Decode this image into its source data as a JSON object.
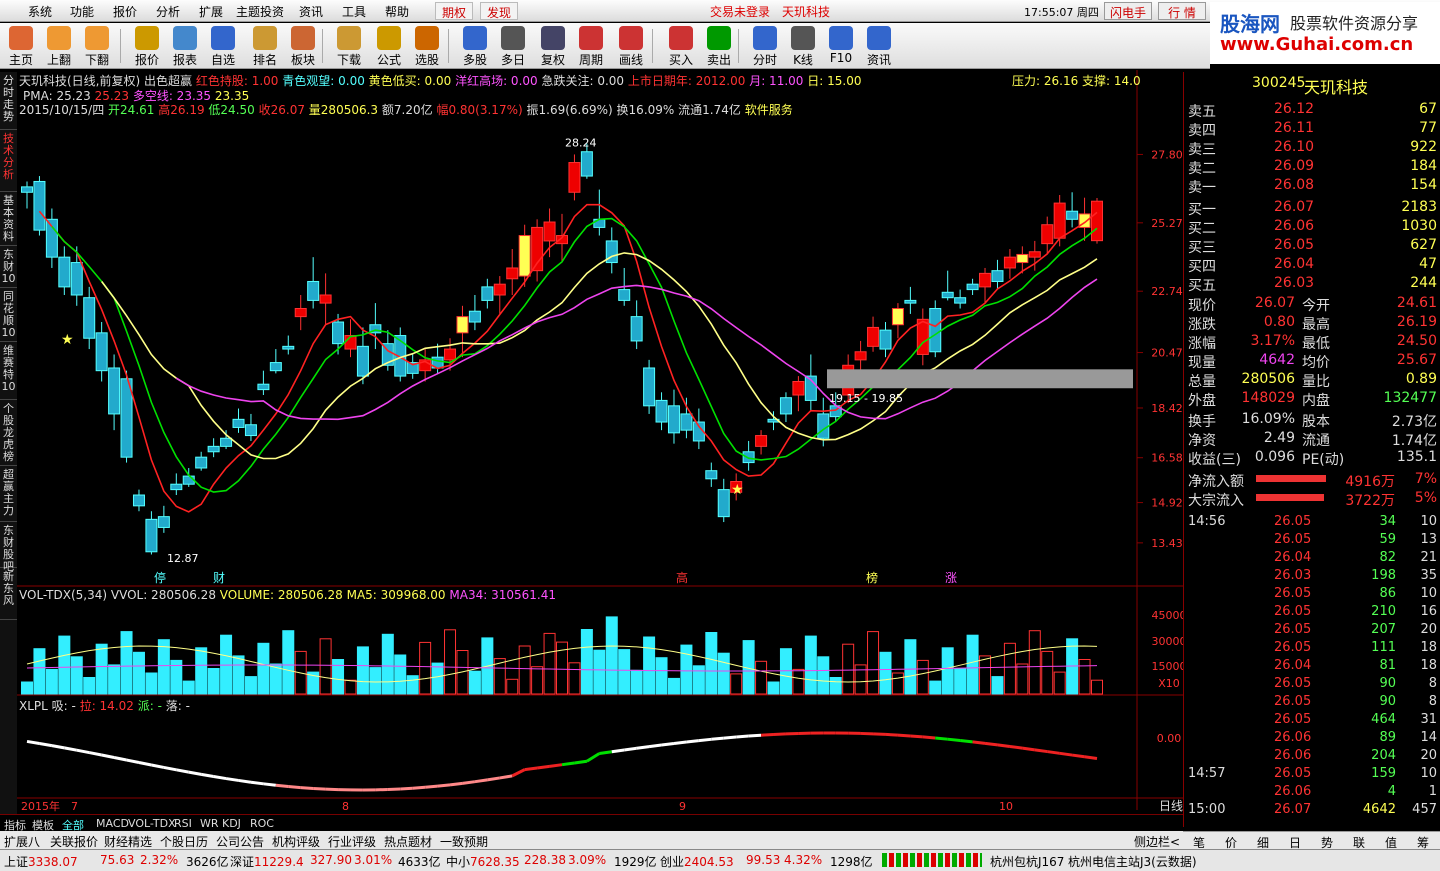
{
  "menu": {
    "items": [
      "系统",
      "功能",
      "报价",
      "分析",
      "扩展",
      "主题投资",
      "资讯",
      "工具",
      "帮助"
    ],
    "tabs": [
      "期权",
      "发现"
    ],
    "notice": "交易未登录",
    "notice_stock": "天玑科技",
    "clock": "17:55:07 周四",
    "btn_flash": "闪电手",
    "btn_quote": "行 情"
  },
  "brand": {
    "site": "股海网",
    "slogan": "股票软件资源分享",
    "url": "www.Guhai.com.cn"
  },
  "toolbar": [
    "主页",
    "上翻",
    "下翻",
    "报价",
    "报表",
    "自选",
    "排名",
    "板块",
    "下载",
    "公式",
    "选股",
    "多股",
    "多日",
    "复权",
    "周期",
    "画线",
    "买入",
    "卖出",
    "分时",
    "K线",
    "F10",
    "资讯"
  ],
  "lefttabs": [
    "分时走势",
    "技术分析",
    "基本资料",
    "东财10",
    "同花顺10",
    "维赛特10",
    "个股龙虎榜",
    "超赢主力",
    "东财股吧",
    "新东风"
  ],
  "header": {
    "title": "天玑科技(日线,前复权)",
    "indicator": "出色超赢",
    "ind1": "红色持股: 1.00",
    "ind2": "青色观望: 0.00",
    "ind3": "黄色低买: 0.00",
    "ind4": "洋红高场: 0.00",
    "ind5": "急跌关注: 0.00",
    "ind6": "上市日期年: 2012.00",
    "ind7": "月: 11.00",
    "ind8": "日: 15.00",
    "pressure": "压力: 26.16",
    "support": "支撑: 14.0",
    "date": "2015/10/15/四",
    "open": "开24.61",
    "high": "高26.19",
    "low": "低24.50",
    "close": "收26.07",
    "vol": "量280506.3",
    "amt": "额7.20亿",
    "chg": "幅0.80(3.17%)",
    "amp": "振1.69(6.69%)",
    "turn": "换16.09%",
    "float": "流通1.74亿",
    "sector": "软件服务",
    "pma": "PMA: 25.23",
    "pma2": "25.23",
    "lk": "多空线: 23.35",
    "lk2": "23.35"
  },
  "price_axis": [
    "27.80",
    "25.27",
    "22.74",
    "20.47",
    "18.42",
    "16.58",
    "14.92",
    "13.43"
  ],
  "annotations": {
    "peak": "28.24",
    "trough": "12.87",
    "band": "19.15 - 19.85",
    "marks": [
      "停",
      "财",
      "高",
      "榜",
      "涨"
    ]
  },
  "vol_header": {
    "title": "VOL-TDX(5,34)",
    "vvol": "VVOL: 280506.28",
    "volume": "VOLUME: 280506.28",
    "ma5": "MA5: 309968.00",
    "ma34": "MA34: 310561.41"
  },
  "vol_axis": [
    "45000",
    "30000",
    "15000",
    "X10"
  ],
  "xlpl_header": {
    "title": "XLPL",
    "a": "吸: -",
    "b": "拉: 14.02",
    "c": "派: -",
    "d": "落: -"
  },
  "xlpl_axis": [
    "0.00"
  ],
  "date_axis": [
    "2015年",
    "7",
    "8",
    "9",
    "10"
  ],
  "period": "日线",
  "chart_data": {
    "type": "candlestick",
    "title": "天玑科技(日线,前复权)",
    "ylim": [
      12.5,
      29.0
    ],
    "last": {
      "date": "2015/10/15",
      "open": 24.61,
      "high": 26.19,
      "low": 24.5,
      "close": 26.07
    },
    "volume_last": 280506.28,
    "ma5": 309968.0,
    "ma34": 310561.41
  },
  "quote": {
    "code": "300245",
    "name": "天玑科技",
    "sell": [
      [
        "卖五",
        "26.12",
        "67"
      ],
      [
        "卖四",
        "26.11",
        "77"
      ],
      [
        "卖三",
        "26.10",
        "922"
      ],
      [
        "卖二",
        "26.09",
        "184"
      ],
      [
        "卖一",
        "26.08",
        "154"
      ]
    ],
    "buy": [
      [
        "买一",
        "26.07",
        "2183"
      ],
      [
        "买二",
        "26.06",
        "1030"
      ],
      [
        "买三",
        "26.05",
        "627"
      ],
      [
        "买四",
        "26.04",
        "47"
      ],
      [
        "买五",
        "26.03",
        "244"
      ]
    ],
    "stats": [
      [
        "现价",
        "26.07",
        "今开",
        "24.61"
      ],
      [
        "涨跌",
        "0.80",
        "最高",
        "26.19"
      ],
      [
        "涨幅",
        "3.17%",
        "最低",
        "24.50"
      ],
      [
        "现量",
        "4642",
        "均价",
        "25.67"
      ],
      [
        "总量",
        "280506",
        "量比",
        "0.89"
      ],
      [
        "外盘",
        "148029",
        "内盘",
        "132477"
      ]
    ],
    "stats2": [
      [
        "换手",
        "16.09%",
        "股本",
        "2.73亿"
      ],
      [
        "净资",
        "2.49",
        "流通",
        "1.74亿"
      ],
      [
        "收益(三)",
        "0.096",
        "PE(动)",
        "135.1"
      ]
    ],
    "flow": [
      [
        "净流入额",
        "4916万",
        "7%"
      ],
      [
        "大宗流入",
        "3722万",
        "5%"
      ]
    ],
    "ticks": [
      [
        "14:56",
        "26.05",
        "34",
        "10"
      ],
      [
        "",
        "26.05",
        "59",
        "13"
      ],
      [
        "",
        "26.04",
        "82",
        "21"
      ],
      [
        "",
        "26.03",
        "198",
        "35"
      ],
      [
        "",
        "26.05",
        "86",
        "10"
      ],
      [
        "",
        "26.05",
        "210",
        "16"
      ],
      [
        "",
        "26.05",
        "207",
        "20"
      ],
      [
        "",
        "26.05",
        "111",
        "18"
      ],
      [
        "",
        "26.04",
        "81",
        "18"
      ],
      [
        "",
        "26.05",
        "90",
        "8"
      ],
      [
        "",
        "26.05",
        "90",
        "8"
      ],
      [
        "",
        "26.05",
        "464",
        "31"
      ],
      [
        "",
        "26.06",
        "89",
        "14"
      ],
      [
        "",
        "26.06",
        "204",
        "20"
      ],
      [
        "14:57",
        "26.05",
        "159",
        "10"
      ],
      [
        "",
        "26.06",
        "4",
        "1"
      ],
      [
        "15:00",
        "26.07",
        "4642",
        "457"
      ]
    ]
  },
  "bottomtabs": [
    "指标",
    "模板",
    "全部",
    "MACD",
    "VOL-TDX",
    "RSI",
    "WR",
    "KDJ",
    "ROC"
  ],
  "bottomtabs2": [
    "扩展八",
    "关联报价",
    "财经精选",
    "个股日历",
    "公司公告",
    "机构评级",
    "行业评级",
    "热点题材",
    "一致预期"
  ],
  "sidebar_btn": "侧边栏<",
  "rtabs": [
    "笔",
    "价",
    "细",
    "日",
    "势",
    "联",
    "值",
    "筹"
  ],
  "status": {
    "sh": "上证",
    "sh_v": "3338.07",
    "sh_c": "75.63",
    "sh_p": "2.32%",
    "sh_a": "3626亿",
    "sz": "深证",
    "sz_v": "11229.4",
    "sz_c": "327.90",
    "sz_p": "3.01%",
    "sz_a": "4633亿",
    "zx": "中小",
    "zx_v": "7628.35",
    "zx_c": "228.38",
    "zx_p": "3.09%",
    "zx_a": "1929亿",
    "cy": "创业",
    "cy_v": "2404.53",
    "cy_c": "99.53",
    "cy_p": "4.32%",
    "cy_a": "1298亿",
    "server": "杭州包杭J167",
    "server2": "杭州电信主站J3(云数据)"
  },
  "colors": {
    "up": "#ff3232",
    "down": "#54ffff",
    "yellow": "#ffff54",
    "magenta": "#ff54ff",
    "green": "#00e000",
    "pink": "#f88"
  }
}
